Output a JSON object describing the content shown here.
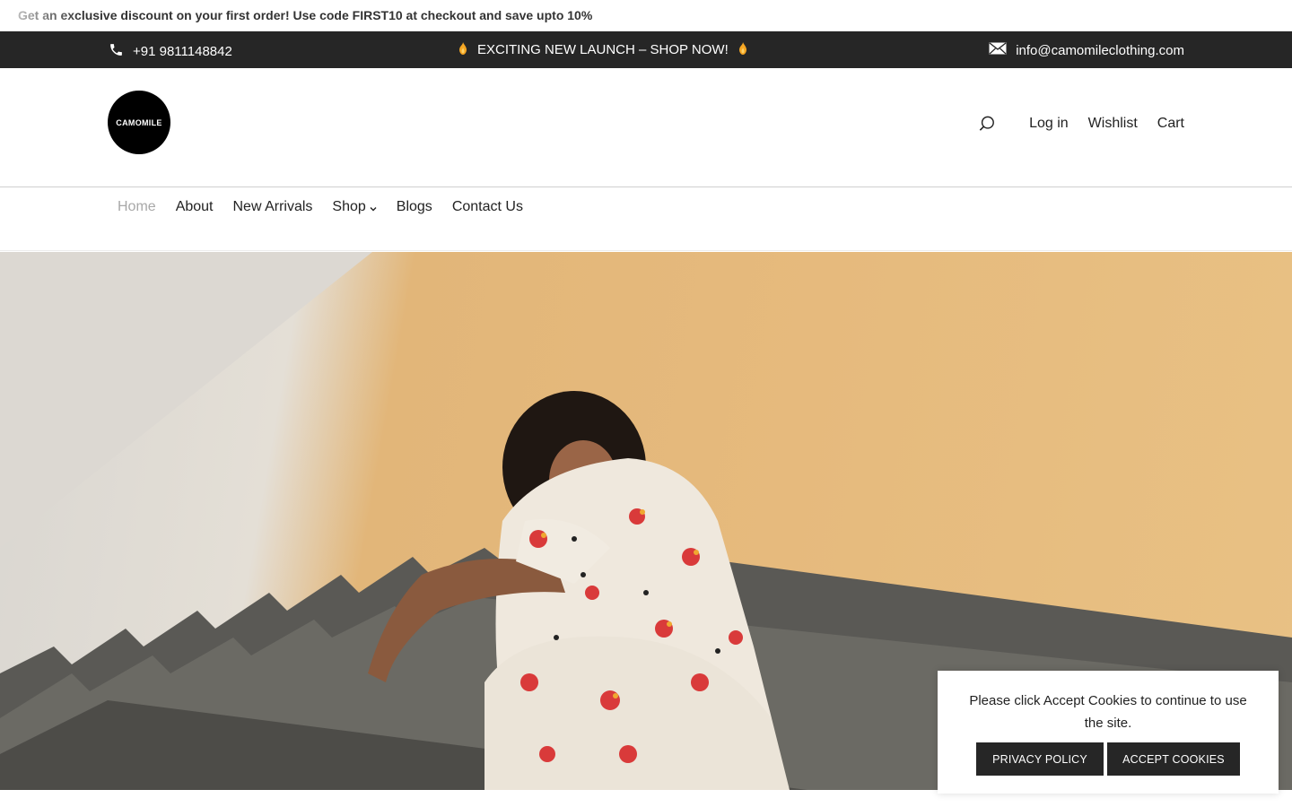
{
  "promo": {
    "text": "Get an exclusive discount on your first order! Use code FIRST10 at checkout and save upto 10%"
  },
  "info_bar": {
    "phone": "+91 9811148842",
    "launch": "EXCITING NEW LAUNCH – SHOP NOW!",
    "email": "info@camomileclothing.com",
    "phone_icon": "phone-icon",
    "email_icon": "envelope-icon",
    "flame_icon": "flame-icon"
  },
  "header": {
    "logo_text": "CAMOMILE",
    "login": "Log in",
    "wishlist": "Wishlist",
    "cart": "Cart",
    "search_icon": "search-icon"
  },
  "nav": {
    "items": [
      {
        "label": "Home",
        "active": true
      },
      {
        "label": "About"
      },
      {
        "label": "New Arrivals"
      },
      {
        "label": "Shop",
        "has_dropdown": true
      },
      {
        "label": "Blogs"
      },
      {
        "label": "Contact Us"
      }
    ]
  },
  "cookie": {
    "message": "Please click Accept Cookies to continue to use the site.",
    "privacy_label": "PRIVACY POLICY",
    "accept_label": "ACCEPT COOKIES"
  },
  "colors": {
    "dark_bar": "#262626",
    "hero_wall": "#e6ba7d",
    "nav_active": "#a8a8a8"
  }
}
